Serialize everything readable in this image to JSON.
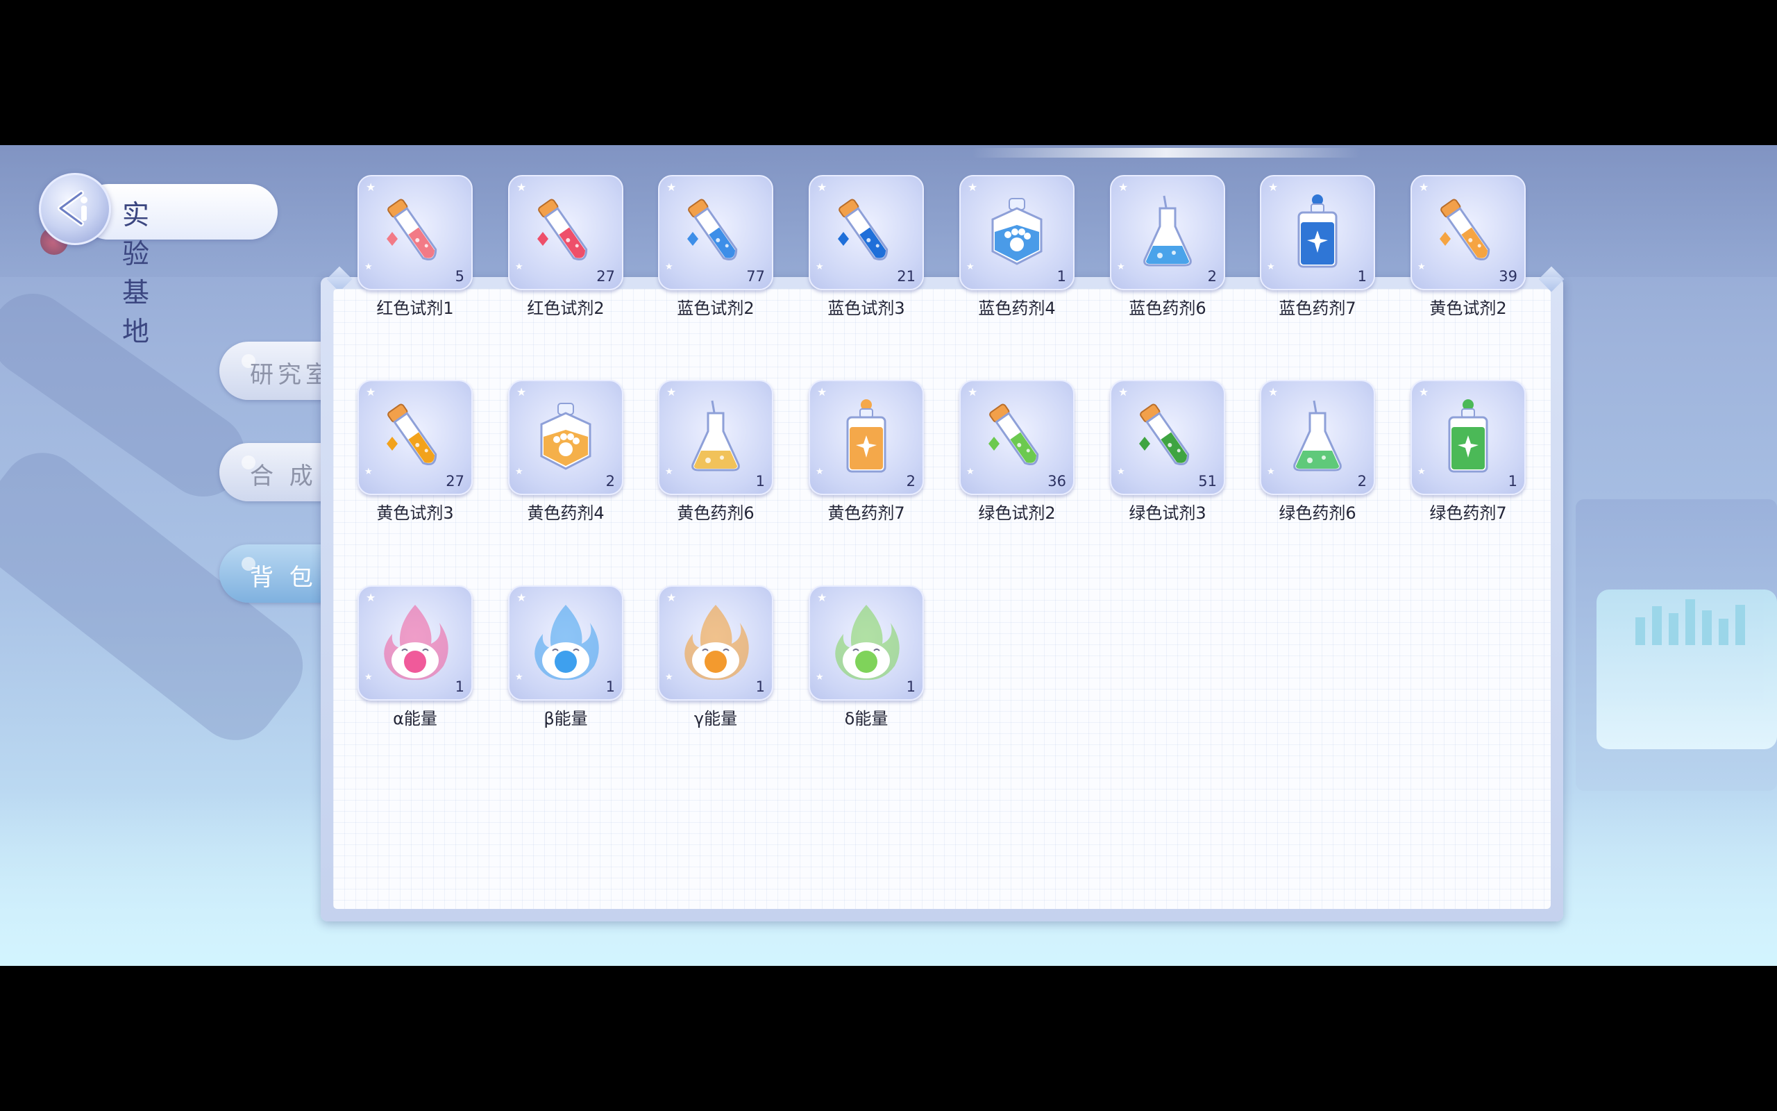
{
  "header": {
    "title": "实验基地"
  },
  "tabs": [
    {
      "label": "研究室",
      "active": false
    },
    {
      "label": "合 成",
      "active": false
    },
    {
      "label": "背 包",
      "active": true
    }
  ],
  "items": [
    {
      "name": "红色试剂1",
      "count": "5",
      "icon": "test-tube-icon",
      "color": "#f27a86"
    },
    {
      "name": "红色试剂2",
      "count": "27",
      "icon": "test-tube-icon",
      "color": "#ee4f6a"
    },
    {
      "name": "蓝色试剂2",
      "count": "77",
      "icon": "test-tube-icon",
      "color": "#3d8ee8"
    },
    {
      "name": "蓝色试剂3",
      "count": "21",
      "icon": "test-tube-icon",
      "color": "#1f6fd9"
    },
    {
      "name": "蓝色药剂4",
      "count": "1",
      "icon": "paw-bottle-icon",
      "color": "#4a9be8"
    },
    {
      "name": "蓝色药剂6",
      "count": "2",
      "icon": "flask-icon",
      "color": "#4aa3ea"
    },
    {
      "name": "蓝色药剂7",
      "count": "1",
      "icon": "square-bottle-icon",
      "color": "#2f76d6"
    },
    {
      "name": "黄色试剂2",
      "count": "39",
      "icon": "test-tube-icon",
      "color": "#f5a442"
    },
    {
      "name": "黄色试剂3",
      "count": "27",
      "icon": "test-tube-icon",
      "color": "#f2a21c"
    },
    {
      "name": "黄色药剂4",
      "count": "2",
      "icon": "paw-bottle-icon",
      "color": "#f5b04a"
    },
    {
      "name": "黄色药剂6",
      "count": "1",
      "icon": "flask-icon",
      "color": "#f1c25a"
    },
    {
      "name": "黄色药剂7",
      "count": "2",
      "icon": "square-bottle-icon",
      "color": "#f4a84a"
    },
    {
      "name": "绿色试剂2",
      "count": "36",
      "icon": "test-tube-icon",
      "color": "#6cc94f"
    },
    {
      "name": "绿色试剂3",
      "count": "51",
      "icon": "test-tube-icon",
      "color": "#3fa441"
    },
    {
      "name": "绿色药剂6",
      "count": "2",
      "icon": "flask-icon",
      "color": "#5fc97a"
    },
    {
      "name": "绿色药剂7",
      "count": "1",
      "icon": "square-bottle-icon",
      "color": "#4bb957"
    },
    {
      "name": "α能量",
      "count": "1",
      "icon": "energy-flame-icon",
      "color": "#f05a9a"
    },
    {
      "name": "β能量",
      "count": "1",
      "icon": "energy-flame-icon",
      "color": "#3ea0ee"
    },
    {
      "name": "γ能量",
      "count": "1",
      "icon": "energy-flame-icon",
      "color": "#f39a2e"
    },
    {
      "name": "δ能量",
      "count": "1",
      "icon": "energy-flame-icon",
      "color": "#7fd35a"
    }
  ]
}
